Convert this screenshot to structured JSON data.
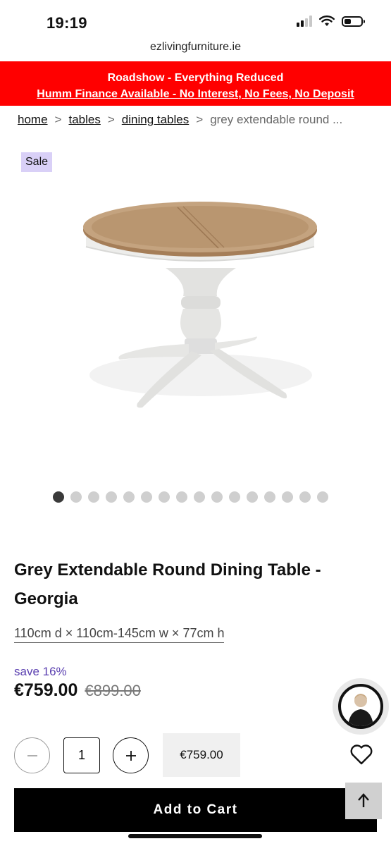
{
  "status_bar": {
    "time": "19:19",
    "signal_bars_active": 2,
    "signal_bars_total": 4,
    "icons": [
      "signal-icon",
      "wifi-icon",
      "battery-icon"
    ]
  },
  "browser": {
    "url": "ezlivingfurniture.ie"
  },
  "promo": {
    "line1": "Roadshow - Everything Reduced",
    "line2": "Humm Finance Available - No Interest, No Fees, No Deposit",
    "color": "#ff0000"
  },
  "breadcrumb": {
    "items": [
      "home",
      "tables",
      "dining tables"
    ],
    "separator": ">",
    "current": "grey extendable round ..."
  },
  "product": {
    "badge": "Sale",
    "title": "Grey Extendable Round Dining Table - Georgia",
    "dimensions": "110cm d × 110cm-145cm w × 77cm h",
    "save": "save 16%",
    "price": "€759.00",
    "was_price": "€899.00",
    "image_count": 16,
    "active_image": 1
  },
  "purchase": {
    "quantity": "1",
    "line_total": "€759.00",
    "add_to_cart_label": "Add to Cart",
    "minus_icon": "minus-icon",
    "plus_icon": "plus-icon",
    "back_to_top_icon": "arrow-up-icon",
    "wishlist_icon": "heart-icon"
  },
  "colors": {
    "accent_purple": "#5a3fb0",
    "badge_bg": "#d9d0f7",
    "cta_bg": "#000000"
  }
}
